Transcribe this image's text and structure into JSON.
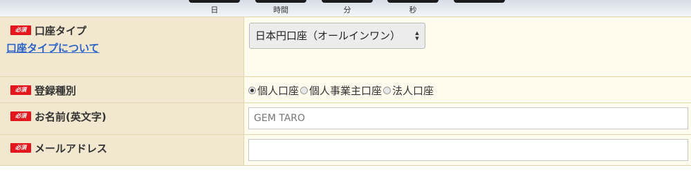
{
  "countdown": {
    "units": [
      "日",
      "時間",
      "分",
      "秒"
    ]
  },
  "form": {
    "required_badge": "必須",
    "account_type": {
      "label": "口座タイプ",
      "help_link": "口座タイプについて",
      "selected": "日本円口座（オールインワン）"
    },
    "registration_type": {
      "label": "登録種別",
      "options": [
        "個人口座",
        "個人事業主口座",
        "法人口座"
      ],
      "selected_index": 0
    },
    "name_en": {
      "label": "お名前(英文字)",
      "placeholder": "GEM TARO"
    },
    "email": {
      "label": "メールアドレス",
      "value": ""
    }
  },
  "colors": {
    "label_bg": "#f1e8cf",
    "value_bg": "#fffbed",
    "required_badge": "#e4171e",
    "link": "#2b63c8"
  }
}
